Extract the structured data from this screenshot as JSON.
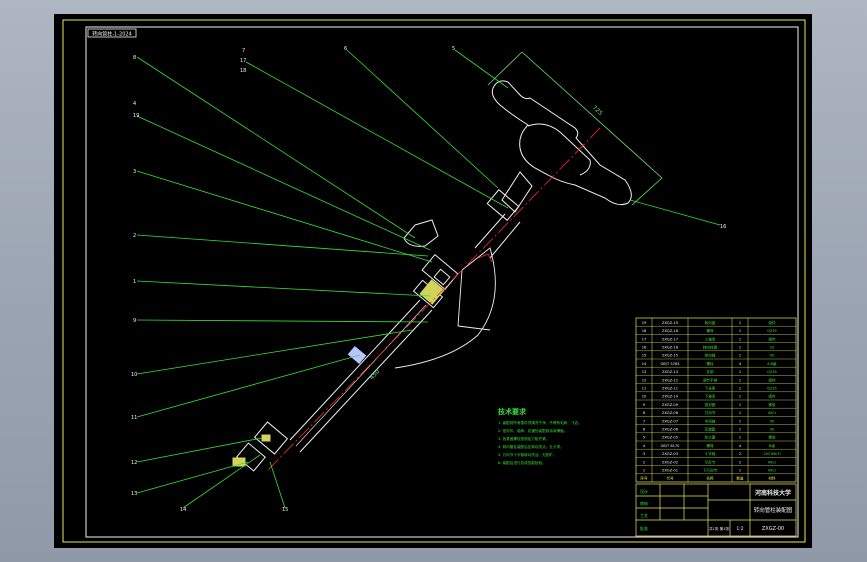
{
  "drawing": {
    "stamp": "转向管柱-1-2024",
    "callouts": [
      "8",
      "7",
      "6",
      "5",
      "4",
      "3",
      "2",
      "1",
      "9",
      "10",
      "11",
      "12",
      "13",
      "14",
      "15",
      "16",
      "17",
      "18",
      "19"
    ],
    "dimensions": [
      "725",
      "450"
    ],
    "tech_req": {
      "title": "技术要求",
      "items": [
        "1. 装配前所有零件须清洗干净，不得有毛刺、飞边。",
        "2. 密封件、轴承、花键处装配前涂润滑脂。",
        "3. 各紧固螺栓按规定力矩拧紧。",
        "4. 转向管柱装配后应转动灵活，无卡滞。",
        "5. 万向节十字轴转动灵活，无松旷。",
        "6. 装配后进行总成性能检验。"
      ]
    },
    "bom": {
      "rows": [
        [
          "19",
          "ZXGZ-19",
          "转向盘",
          "1",
          "组件"
        ],
        [
          "18",
          "ZXGZ-18",
          "螺母",
          "1",
          "Q235"
        ],
        [
          "17",
          "ZXGZ-17",
          "上轴承",
          "1",
          "组件"
        ],
        [
          "16",
          "ZXGZ-16",
          "转向柱管",
          "1",
          "20"
        ],
        [
          "15",
          "ZXGZ-15",
          "转向轴",
          "1",
          "45"
        ],
        [
          "14",
          "GB/T 5783",
          "螺栓",
          "4",
          "8.8级"
        ],
        [
          "13",
          "ZXGZ-13",
          "支架",
          "1",
          "Q235"
        ],
        [
          "12",
          "ZXGZ-12",
          "调节手柄",
          "1",
          "组件"
        ],
        [
          "11",
          "ZXGZ-11",
          "下支架",
          "1",
          "Q235"
        ],
        [
          "10",
          "ZXGZ-10",
          "下轴承",
          "1",
          "组件"
        ],
        [
          "9",
          "ZXGZ-09",
          "密封圈",
          "1",
          "橡胶"
        ],
        [
          "8",
          "ZXGZ-08",
          "万向节",
          "1",
          "40Cr"
        ],
        [
          "7",
          "ZXGZ-07",
          "中间轴",
          "1",
          "45"
        ],
        [
          "6",
          "ZXGZ-06",
          "花键套",
          "1",
          "45"
        ],
        [
          "5",
          "ZXGZ-05",
          "防尘罩",
          "1",
          "橡胶"
        ],
        [
          "4",
          "GB/T 6170",
          "螺母",
          "4",
          "8级"
        ],
        [
          "3",
          "ZXGZ-03",
          "十字轴",
          "2",
          "20CrMnTi"
        ],
        [
          "2",
          "ZXGZ-02",
          "叉形节",
          "2",
          "40Cr"
        ],
        [
          "1",
          "ZXGZ-01",
          "下万向节",
          "1",
          "40Cr"
        ]
      ],
      "header": [
        "序号",
        "代号",
        "名称",
        "数量",
        "材料"
      ]
    },
    "title_block": {
      "school": "河南科技大学",
      "drawing_name": "转向管柱装配图",
      "code": "ZXGZ-00",
      "scale": "1:2",
      "sheet": "共1张 第1张",
      "row_labels": [
        "设计",
        "审核",
        "工艺",
        "批准"
      ]
    }
  }
}
